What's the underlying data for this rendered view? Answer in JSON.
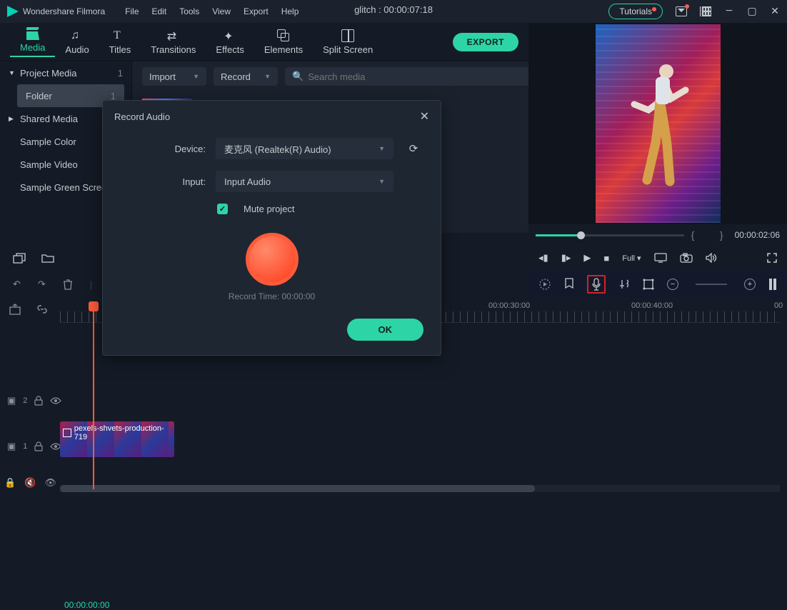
{
  "app_name": "Wondershare Filmora",
  "menubar": {
    "file": "File",
    "edit": "Edit",
    "tools": "Tools",
    "view": "View",
    "export": "Export",
    "help": "Help"
  },
  "project_title": "glitch : 00:00:07:18",
  "titlebar": {
    "tutorials": "Tutorials"
  },
  "tabs": {
    "media": "Media",
    "audio": "Audio",
    "titles": "Titles",
    "transitions": "Transitions",
    "effects": "Effects",
    "elements": "Elements",
    "split": "Split Screen"
  },
  "export_btn": "EXPORT",
  "sidebar": {
    "items": [
      {
        "label": "Project Media",
        "count": "1",
        "caret": "▼"
      },
      {
        "label": "Folder",
        "count": "1",
        "sel": true
      },
      {
        "label": "Shared Media",
        "caret": "▶"
      },
      {
        "label": "Sample Color"
      },
      {
        "label": "Sample Video"
      },
      {
        "label": "Sample Green Screen"
      }
    ]
  },
  "mediabar": {
    "import": "Import",
    "record": "Record",
    "search_ph": "Search media"
  },
  "preview": {
    "time": "00:00:02:06",
    "full": "Full"
  },
  "timeline": {
    "time_indicator": "00:00:00:00",
    "ticks": [
      "00:00:30:00",
      "00:00:40:00",
      "00"
    ],
    "clip_name": "pexels-shvets-production-719"
  },
  "dialog": {
    "title": "Record Audio",
    "device_label": "Device:",
    "device_value": "麦克风 (Realtek(R) Audio)",
    "input_label": "Input:",
    "input_value": "Input Audio",
    "mute": "Mute project",
    "rec_time": "Record Time: 00:00:00",
    "ok": "OK"
  },
  "track_labels": {
    "v2": "2",
    "v1": "1"
  }
}
